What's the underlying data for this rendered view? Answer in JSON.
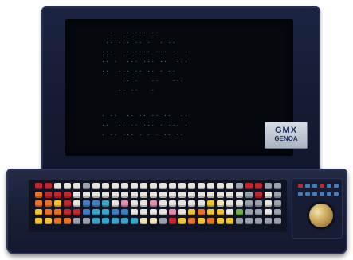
{
  "device": {
    "badge_line1": "GMX",
    "badge_line2": "GENOA"
  },
  "screen": {
    "lines": [
      "   ·  ·· ··· ··",
      "  ·· ··· ·· ·  · ··",
      " ···  ·· ···· ··· ·· ·",
      " ·· ·  ··· ··· ··  ···",
      " ··  ··· ·· ·· · ··",
      "      ·· ·   ··   ···",
      "     ·· ··   ·",
      "",
      " · ··  ·· ·· ·· ··  ··",
      " ··  ·· ·· ··· · ··· ·",
      " · ·· ··· · · · ·· ··"
    ]
  },
  "colors": {
    "key_red": "#c3262d",
    "key_orange": "#e8742a",
    "key_yellow": "#f0c531",
    "key_white": "#e6e4dc",
    "key_grey": "#9aa3ad",
    "key_blue": "#3f7fc1",
    "key_cyan": "#38a6c9",
    "key_pink": "#e58bb0",
    "key_green": "#6fae4b",
    "key_cream": "#efe3b8"
  }
}
